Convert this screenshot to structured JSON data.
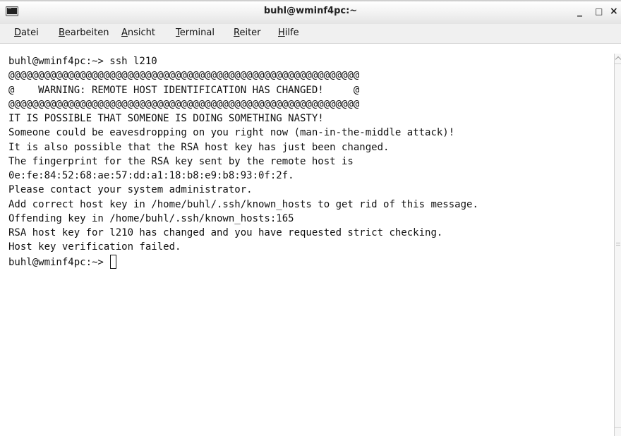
{
  "window": {
    "title": "buhl@wminf4pc:~",
    "icon": "terminal-icon",
    "controls": {
      "minimize": "_",
      "maximize": "□",
      "close": "×"
    }
  },
  "menu": [
    "Datei",
    "Bearbeiten",
    "Ansicht",
    "Terminal",
    "Reiter",
    "Hilfe"
  ],
  "terminal": {
    "lines": [
      "buhl@wminf4pc:~> ssh l210",
      "@@@@@@@@@@@@@@@@@@@@@@@@@@@@@@@@@@@@@@@@@@@@@@@@@@@@@@@@@@@",
      "@    WARNING: REMOTE HOST IDENTIFICATION HAS CHANGED!     @",
      "@@@@@@@@@@@@@@@@@@@@@@@@@@@@@@@@@@@@@@@@@@@@@@@@@@@@@@@@@@@",
      "IT IS POSSIBLE THAT SOMEONE IS DOING SOMETHING NASTY!",
      "Someone could be eavesdropping on you right now (man-in-the-middle attack)!",
      "It is also possible that the RSA host key has just been changed.",
      "The fingerprint for the RSA key sent by the remote host is",
      "0e:fe:84:52:68:ae:57:dd:a1:18:b8:e9:b8:93:0f:2f.",
      "Please contact your system administrator.",
      "Add correct host key in /home/buhl/.ssh/known_hosts to get rid of this message.",
      "Offending key in /home/buhl/.ssh/known_hosts:165",
      "RSA host key for l210 has changed and you have requested strict checking.",
      "Host key verification failed."
    ],
    "prompt": "buhl@wminf4pc:~>"
  }
}
